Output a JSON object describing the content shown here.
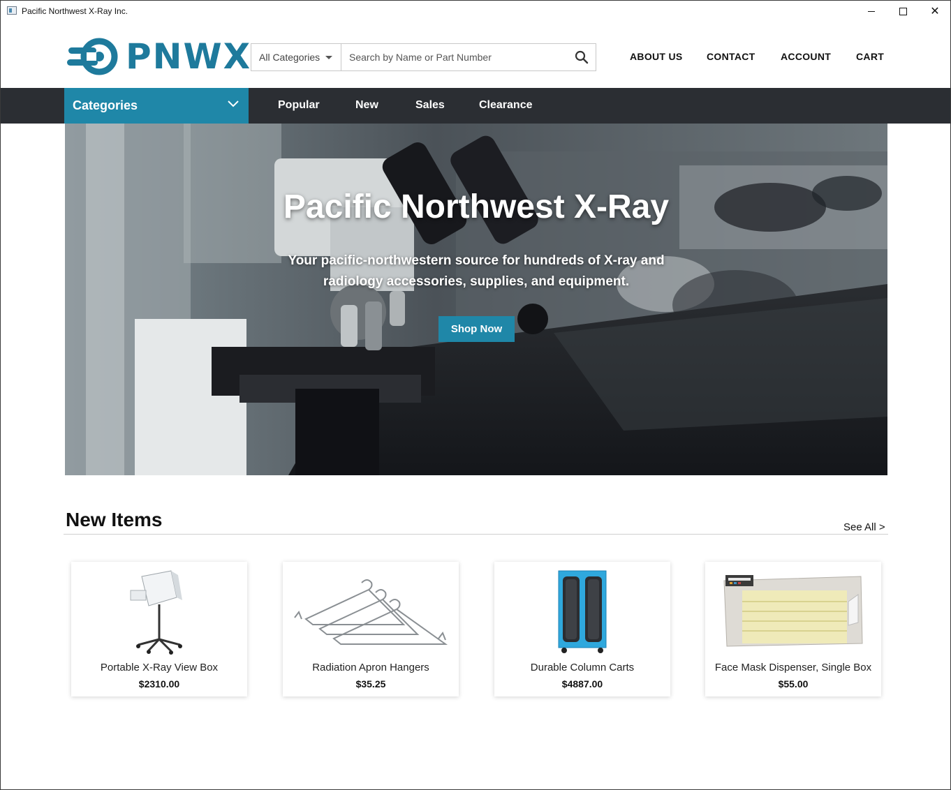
{
  "window": {
    "title": "Pacific Northwest X-Ray Inc."
  },
  "header": {
    "logo_text": "PNWX",
    "search": {
      "category_selected": "All Categories",
      "placeholder": "Search by Name or Part Number"
    },
    "nav": [
      "ABOUT US",
      "CONTACT",
      "ACCOUNT",
      "CART"
    ]
  },
  "navbar": {
    "categories_label": "Categories",
    "links": [
      "Popular",
      "New",
      "Sales",
      "Clearance"
    ]
  },
  "hero": {
    "title": "Pacific Northwest X-Ray",
    "subtitle": "Your pacific-northwestern source for hundreds of X-ray and radiology accessories, supplies, and equipment.",
    "cta": "Shop Now"
  },
  "new_items": {
    "heading": "New Items",
    "see_all": "See All >",
    "items": [
      {
        "name": "Portable X-Ray View Box",
        "price": "$2310.00",
        "image": "view-box-stand"
      },
      {
        "name": "Radiation Apron Hangers",
        "price": "$35.25",
        "image": "apron-hangers"
      },
      {
        "name": "Durable Column Carts",
        "price": "$4887.00",
        "image": "column-cart"
      },
      {
        "name": "Face Mask Dispenser, Single Box",
        "price": "$55.00",
        "image": "mask-dispenser"
      }
    ]
  },
  "colors": {
    "brand": "#1f87a8",
    "navbar": "#2b2e33"
  }
}
